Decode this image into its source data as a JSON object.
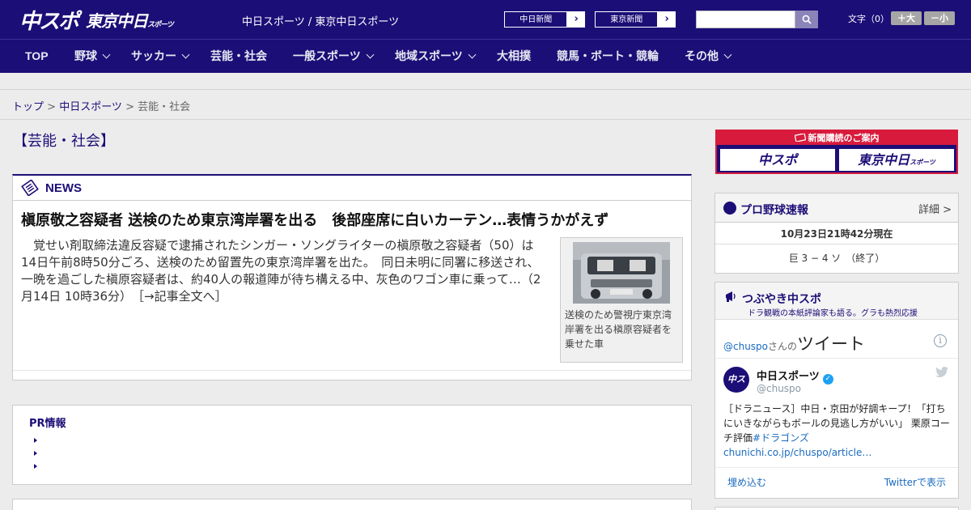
{
  "header": {
    "logo_main": "中スポ",
    "logo_sub": "東京中日",
    "logo_sub_small": "スポーツ",
    "site_link": "中日スポーツ / 東京中日スポーツ",
    "paper_buttons": [
      {
        "label": "中日新聞",
        "arrow": "›"
      },
      {
        "label": "東京新聞",
        "arrow": "›"
      }
    ],
    "search": {
      "placeholder": "",
      "icon": "search-icon"
    },
    "fontsize_label": "文字（0）",
    "fontsize_plus": "＋大",
    "fontsize_minus": "－小"
  },
  "nav": {
    "items": [
      {
        "label": "TOP",
        "dropdown": false
      },
      {
        "label": "野球",
        "dropdown": true
      },
      {
        "label": "サッカー",
        "dropdown": true
      },
      {
        "label": "芸能・社会",
        "dropdown": false
      },
      {
        "label": "一般スポーツ",
        "dropdown": true
      },
      {
        "label": "地域スポーツ",
        "dropdown": true
      },
      {
        "label": "大相撲",
        "dropdown": false
      },
      {
        "label": "競馬・ボート・競輪",
        "dropdown": false
      },
      {
        "label": "その他",
        "dropdown": true
      }
    ]
  },
  "breadcrumb": {
    "home": "トップ",
    "sep": " > ",
    "section": "中日スポーツ",
    "current": "芸能・社会"
  },
  "category_title": "【芸能・社会】",
  "news": {
    "section_title": "NEWS",
    "headline": "槇原敬之容疑者 送検のため東京湾岸署を出る　後部座席に白いカーテン…表情うかがえず",
    "body": "覚せい剤取締法違反容疑で逮捕されたシンガー・ソングライターの槇原敬之容疑者（50）は14日午前8時50分ごろ、送検のため留置先の東京湾岸署を出た。　同日未明に同署に移送され、一晩を過ごした槇原容疑者は、約40人の報道陣が待ち構える中、灰色のワゴン車に乗って…（2月14日 10時36分）　［→記事全文へ］",
    "photo_caption": "送検のため警視庁東京湾岸署を出る槇原容疑者を乗せた車"
  },
  "pr": {
    "title": "PR情報",
    "items": [
      "",
      "",
      ""
    ]
  },
  "subscribe": {
    "title": "新聞購読のご案内",
    "buttons": [
      "中スポ",
      "東京中日"
    ],
    "button_small": "スポーツ"
  },
  "baseball": {
    "title": "プロ野球速報",
    "more": "詳細 >",
    "timestamp": "10月23日21時42分現在",
    "score": "巨 3 − 4 ソ　（終了）"
  },
  "tweets": {
    "title": "つぶやき中スポ",
    "subtitle": "ドラ観戦の本紙評論家も語る。グラも熱烈応援",
    "feed_handle": "@chuspo",
    "feed_san": "さんの",
    "feed_label": "ツイート",
    "author_name": "中日スポーツ",
    "author_handle": "@chuspo",
    "avatar_text": "中スポ",
    "text": "［ドラニュース］中日・京田が好調キープ！「打ちにいきながらもボールの見逃し方がいい」 栗原コーチ評価",
    "text_link": "#ドラゴンズchunichi.co.jp/chuspo/article…",
    "embed": "埋め込む",
    "view": "Twitterで表示"
  },
  "colors": {
    "brand": "#1c0e77",
    "accent_red": "#d81b3c",
    "link_blue": "#1a6bbf"
  }
}
